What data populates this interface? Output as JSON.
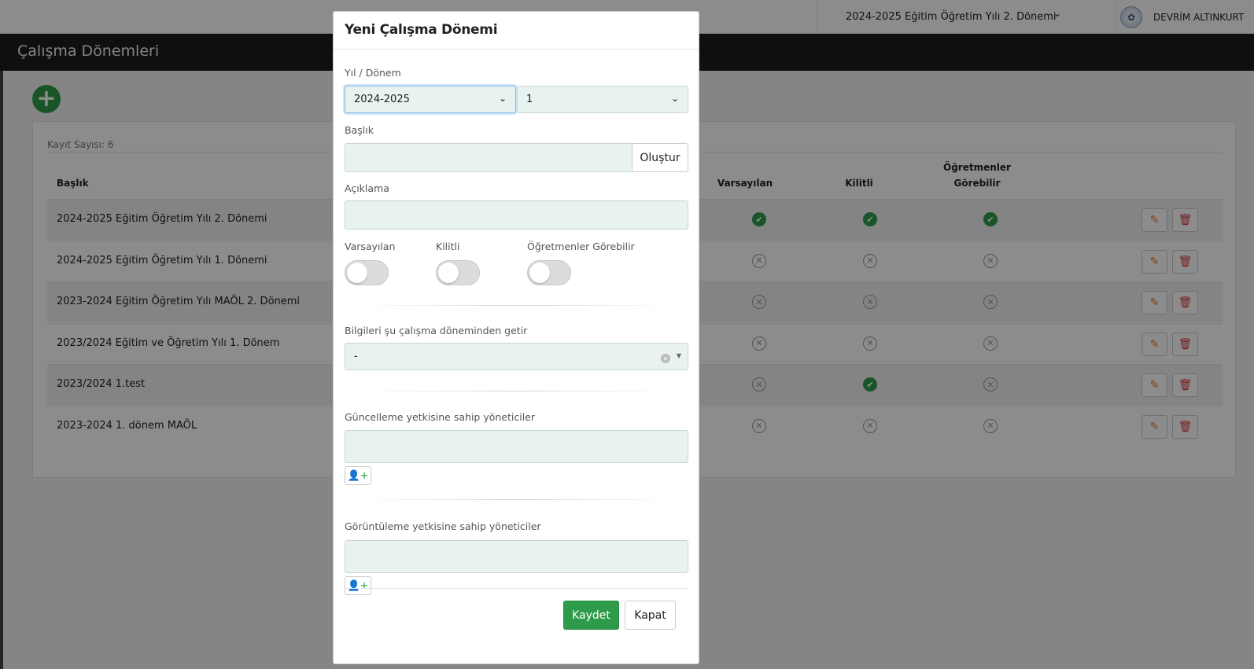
{
  "header": {
    "period_label": "2024-2025 Eğitim Öğretim Yılı 2. Dönemi",
    "user_name": "DEVRİM ALTINKURT"
  },
  "page": {
    "title": "Çalışma Dönemleri",
    "record_count": "Kayıt Sayısı: 6"
  },
  "table": {
    "columns": {
      "title": "Başlık",
      "default": "Varsayılan",
      "locked": "Kilitli",
      "teachers_line1": "Öğretmenler",
      "teachers_line2": "Görebilir"
    },
    "rows": [
      {
        "title": "2024-2025 Eğitim Öğretim Yılı 2. Dönemi",
        "default": true,
        "locked": true,
        "teachers": true
      },
      {
        "title": "2024-2025 Eğitim Öğretim Yılı 1. Dönemi",
        "default": false,
        "locked": false,
        "teachers": false
      },
      {
        "title": "2023-2024 Eğitim Öğretim Yılı MAÖL 2. Dönemi",
        "default": false,
        "locked": false,
        "teachers": false
      },
      {
        "title": "2023/2024 Eğitim ve Öğretim Yılı 1. Dönem",
        "default": false,
        "locked": false,
        "teachers": false
      },
      {
        "title": "2023/2024 1.test",
        "default": false,
        "locked": true,
        "teachers": false
      },
      {
        "title": "2023-2024 1. dönem MAÖL",
        "default": false,
        "locked": false,
        "teachers": false
      }
    ]
  },
  "modal": {
    "title": "Yeni Çalışma Dönemi",
    "year_term_label": "Yıl / Dönem",
    "year_value": "2024-2025",
    "term_value": "1",
    "title_label": "Başlık",
    "title_value": "",
    "generate_button": "Oluştur",
    "description_label": "Açıklama",
    "description_value": "",
    "toggles": {
      "default_label": "Varsayılan",
      "default_on": false,
      "locked_label": "Kilitli",
      "locked_on": false,
      "teachers_label": "Öğretmenler Görebilir",
      "teachers_on": false
    },
    "copy_from_label": "Bilgileri şu çalışma döneminden getir",
    "copy_from_value": "-",
    "update_admins_label": "Güncelleme yetkisine sahip yöneticiler",
    "view_admins_label": "Görüntüleme yetkisine sahip yöneticiler",
    "save_button": "Kaydet",
    "close_button": "Kapat"
  },
  "colors": {
    "accent_green": "#2e9b4a",
    "field_bg": "#e8f2ee",
    "edit_orange": "#e07a2c",
    "delete_red": "#d43c3c"
  }
}
